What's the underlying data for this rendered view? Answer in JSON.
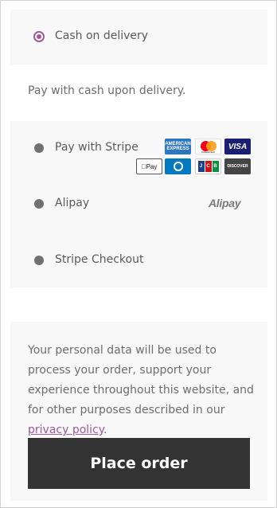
{
  "payment_methods": {
    "cod": {
      "label": "Cash on delivery",
      "selected": true,
      "description": "Pay with cash upon delivery."
    },
    "stripe": {
      "label": "Pay with Stripe",
      "cards": [
        "American Express",
        "Mastercard",
        "Visa",
        "Apple Pay",
        "Diners Club",
        "JCB",
        "Discover"
      ],
      "amex_text": "AMERICAN EXPRESS",
      "mastercard_text": "mastercard",
      "visa_text": "VISA",
      "applepay_text": "Pay",
      "jcb_text": "JCB",
      "discover_text": "DISCOVER"
    },
    "alipay": {
      "label": "Alipay",
      "logo_text": "Alipay"
    },
    "stripe_checkout": {
      "label": "Stripe Checkout"
    }
  },
  "privacy": {
    "text_before": "Your personal data will be used to process your order, support your experience throughout this website, and for other purposes described in our ",
    "link_text": "privacy policy",
    "text_after": "."
  },
  "place_order": {
    "label": "Place order"
  },
  "colors": {
    "accent": "#9c5b96",
    "button_bg": "#333333",
    "panel_bg": "#f8f8f8"
  }
}
